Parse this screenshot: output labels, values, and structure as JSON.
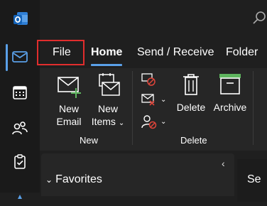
{
  "app": {
    "logo_icon": "outlook-logo-icon"
  },
  "rail": {
    "items": [
      {
        "icon": "mail-icon",
        "active": true
      },
      {
        "icon": "calendar-icon",
        "active": false
      },
      {
        "icon": "people-icon",
        "active": false
      },
      {
        "icon": "todo-icon",
        "active": false
      }
    ]
  },
  "tabs": {
    "file": "File",
    "home": "Home",
    "send_receive": "Send / Receive",
    "folder": "Folder"
  },
  "ribbon": {
    "new_group": {
      "new_email_line1": "New",
      "new_email_line2": "Email",
      "new_items_line1": "New",
      "new_items_line2": "Items",
      "label": "New"
    },
    "delete_group": {
      "delete": "Delete",
      "archive": "Archive",
      "label": "Delete"
    }
  },
  "folder_pane": {
    "favorites": "Favorites"
  },
  "reading_pane": {
    "partial_text": "Se"
  },
  "colors": {
    "accent": "#5aa0e8",
    "highlight_box": "#e12d2d",
    "archive_green": "#5fb55f",
    "new_plus_green": "#5fb55f",
    "delete_red": "#e0453a"
  }
}
